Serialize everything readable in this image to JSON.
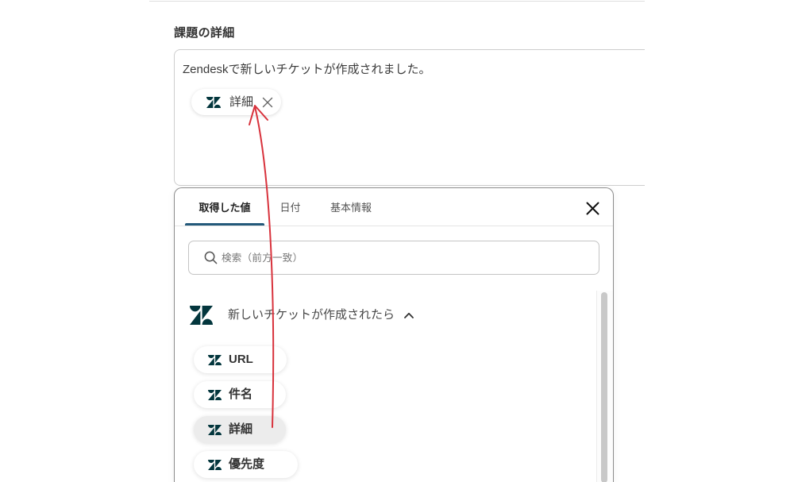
{
  "colors": {
    "accent": "#23597a",
    "zendesk_icon": "#03363d",
    "annotation_arrow": "#d8323c"
  },
  "field": {
    "label": "課題の詳細",
    "text": "Zendeskで新しいチケットが作成されました。",
    "chip": {
      "icon": "zendesk-icon",
      "label": "詳細",
      "remove_icon": "close-icon"
    }
  },
  "picker": {
    "tabs": [
      {
        "label": "取得した値",
        "active": true
      },
      {
        "label": "日付",
        "active": false
      },
      {
        "label": "基本情報",
        "active": false
      }
    ],
    "close_icon": "close-icon",
    "search": {
      "icon": "search-icon",
      "placeholder": "検索（前方一致）",
      "value": ""
    },
    "section": {
      "icon": "zendesk-icon",
      "title": "新しいチケットが作成されたら",
      "toggle_icon": "chevron-up-icon",
      "expanded": true
    },
    "items": [
      {
        "icon": "zendesk-icon",
        "label": "URL",
        "hovered": false
      },
      {
        "icon": "zendesk-icon",
        "label": "件名",
        "hovered": false
      },
      {
        "icon": "zendesk-icon",
        "label": "詳細",
        "hovered": true
      },
      {
        "icon": "zendesk-icon",
        "label": "優先度",
        "hovered": false
      }
    ]
  },
  "annotation": {
    "arrow_icon": "curved-arrow-icon"
  }
}
